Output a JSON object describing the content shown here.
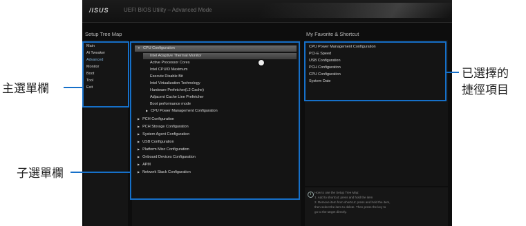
{
  "header": {
    "logo": "/ISUS",
    "title": "UEFI BIOS Utility – Advanced Mode"
  },
  "sections": {
    "setup_tree_map": "Setup Tree Map",
    "favorites": "My Favorite & Shortcut"
  },
  "main_menu": [
    {
      "label": "Main",
      "active": false
    },
    {
      "label": "Ai Tweaker",
      "active": false
    },
    {
      "label": "Advanced",
      "active": true
    },
    {
      "label": "Monitor",
      "active": false
    },
    {
      "label": "Boot",
      "active": false
    },
    {
      "label": "Tool",
      "active": false
    },
    {
      "label": "Exit",
      "active": false
    }
  ],
  "submenu": {
    "cpu_configuration": "CPU Configuration",
    "cpu_children": [
      "Intel Adaptive Thermal Monitor",
      "Active Processor Cores",
      "Intel CPUID Maximum",
      "Execute Disable Bit",
      "Intel Virtualization Technology",
      "Hardware Prefetcher(L2 Cache)",
      "Adjacent Cache Line Prefetcher",
      "Boot performance mode"
    ],
    "cpu_power": "CPU Power Management Configuration",
    "items": [
      "PCH Configuration",
      "PCH Storage Configuration",
      "System Agent Configuration",
      "USB Configuration",
      "Platform Misc Configuration",
      "Onboard Devices Configuration",
      "APM",
      "Network Stack Configuration"
    ]
  },
  "favorites": [
    "CPU Power Management Configuration",
    "PCI-E Speed",
    "USB Configuration",
    "PCH Configuration",
    "CPU Configuration",
    "System Date"
  ],
  "hint": [
    "How to use the Setup Tree Map:",
    "1. Add to shortcut: press and hold the item",
    "2. Remove item from shortcut: press and hold the item,",
    "   then select the item to delete. Then press the key to",
    "   go to the target directly."
  ],
  "callouts": {
    "main_menu_bar": "主選單欄",
    "submenu_bar": "子選單欄",
    "selected_shortcuts_line1": "已選擇的",
    "selected_shortcuts_line2": "捷徑項目"
  },
  "colors": {
    "callout_box": "#1670c9",
    "active_menu": "#7fb0d8",
    "panel_bg": "#141414"
  }
}
